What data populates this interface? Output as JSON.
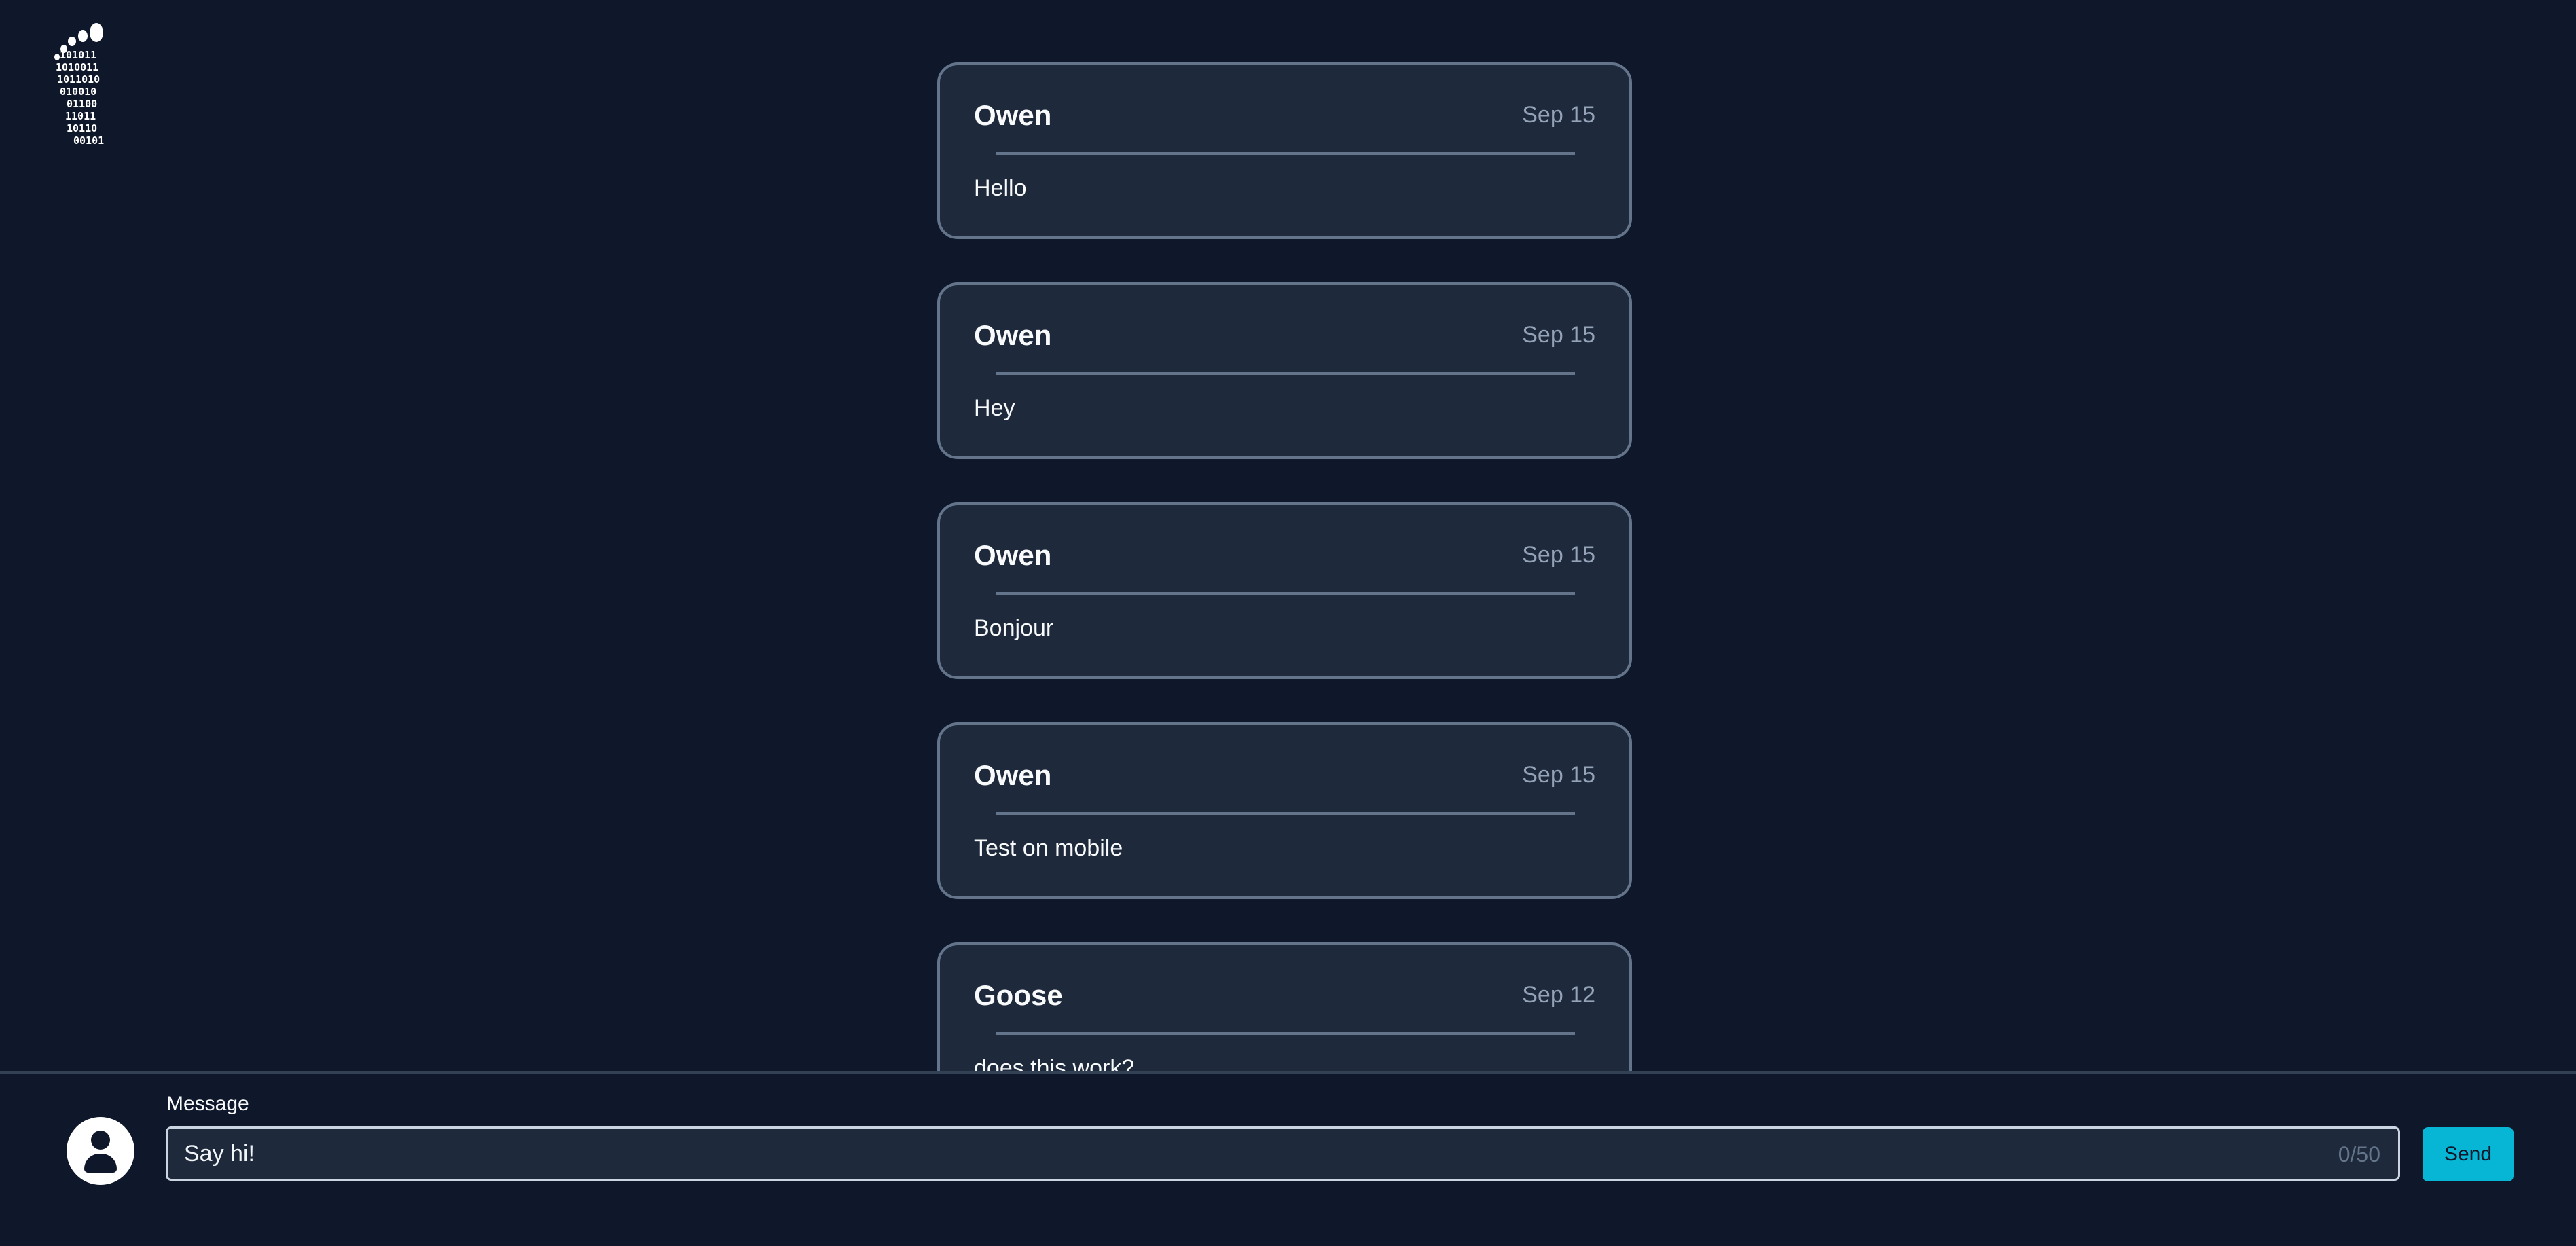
{
  "logo": {
    "alt": "binary footprint logo",
    "binary_lines": [
      "101011",
      "1010011",
      "1011010",
      "010010",
      "01100",
      "11011",
      "10110",
      "00101"
    ]
  },
  "messages": [
    {
      "author": "Owen",
      "date": "Sep 15",
      "text": "Hello"
    },
    {
      "author": "Owen",
      "date": "Sep 15",
      "text": "Hey"
    },
    {
      "author": "Owen",
      "date": "Sep 15",
      "text": "Bonjour"
    },
    {
      "author": "Owen",
      "date": "Sep 15",
      "text": "Test on mobile"
    },
    {
      "author": "Goose",
      "date": "Sep 12",
      "text": "does this work?"
    }
  ],
  "composer": {
    "avatar_icon": "user-icon",
    "label": "Message",
    "placeholder": "Say hi!",
    "counter": "0/50",
    "send_label": "Send"
  },
  "colors": {
    "background": "#0f172a",
    "card": "#1e293b",
    "border": "#64748b",
    "accent": "#06b6d4"
  }
}
